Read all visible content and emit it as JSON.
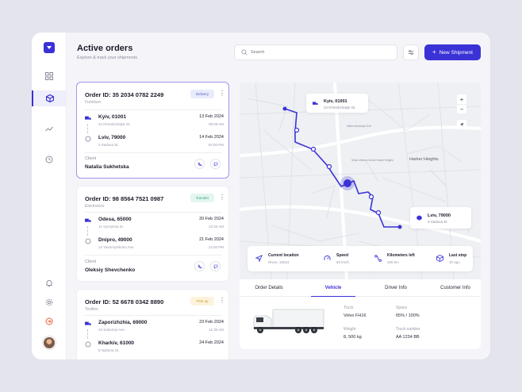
{
  "header": {
    "title": "Active orders",
    "subtitle": "Explore & track your shipments",
    "search_placeholder": "Search",
    "new_button": "New Shipment"
  },
  "colors": {
    "accent": "#3a32d6",
    "delivery_bg": "#e9ecfb",
    "delivery_fg": "#5a62c9",
    "transfer_bg": "#e3f6ef",
    "transfer_fg": "#3aa47a",
    "pickup_bg": "#fdf3dc",
    "pickup_fg": "#c89a2b",
    "logout": "#e8603a"
  },
  "sidebar": {
    "items": [
      "logo-icon",
      "grid-icon",
      "box-icon",
      "chart-icon",
      "history-icon",
      "bell-icon",
      "settings-icon",
      "logout-icon"
    ]
  },
  "orders": [
    {
      "id": "Order ID: 35 2034 0782 2249",
      "category": "Furniture",
      "status": "Delivery",
      "from": {
        "city": "Kyiv, 01001",
        "address": "24 Khreshchatyk St.",
        "date": "13 Feb 2024",
        "time": "09:08 AM"
      },
      "to": {
        "city": "Lviv, 79000",
        "address": "3 Sadova St.",
        "date": "14 Feb 2024",
        "time": "02:00 PM"
      },
      "client_label": "Client",
      "client": "Natalia Sukhetska"
    },
    {
      "id": "Order ID: 98 8564 7521 0987",
      "category": "Electronics",
      "status": "Transfer",
      "from": {
        "city": "Odesa, 65000",
        "address": "11 Vynnytsia St.",
        "date": "20 Feb 2024",
        "time": "10:35 AM"
      },
      "to": {
        "city": "Dnipro, 49000",
        "address": "12 Yavornytskoho Ave.",
        "date": "21 Feb 2024",
        "time": "12:00 PM"
      },
      "client_label": "Client",
      "client": "Oleksiy Shevchenko"
    },
    {
      "id": "Order ID: 52 6678 0342 8890",
      "category": "Textiles",
      "status": "Pick up",
      "from": {
        "city": "Zaporizhzhia, 69000",
        "address": "23 Sobornyi Ave.",
        "date": "23 Feb 2024",
        "time": "11:30 AM"
      },
      "to": {
        "city": "Kharkiv, 61000",
        "address": "8 Nahirna St.",
        "date": "24 Feb 2024",
        "time": ""
      }
    }
  ],
  "map": {
    "origin": {
      "city": "Kyiv, 01001",
      "address": "24 Khreshchatyk St."
    },
    "destination": {
      "city": "Lviv, 79000",
      "address": "3 Sadova St."
    },
    "labels": [
      "Harker Heights",
      "Killeen Municipal Golf",
      "Seton Medical Center Harker Heights"
    ],
    "stats": [
      {
        "label": "Current location",
        "value": "Rivne, 33024"
      },
      {
        "label": "Speed",
        "value": "80 km/h"
      },
      {
        "label": "Kilometers left",
        "value": "290 km"
      },
      {
        "label": "Last stop",
        "value": "3h ago"
      }
    ]
  },
  "details": {
    "tabs": [
      "Order Details",
      "Vehicle",
      "Driver Info",
      "Customer Info"
    ],
    "active_tab": "Vehicle",
    "truck_label": "Truck",
    "truck": "Volvo FH16",
    "space_label": "Space",
    "space": "65% / 100%",
    "weight_label": "Weight",
    "weight": "8, 500 kg",
    "number_label": "Truck number",
    "number": "AA 1234 BB"
  }
}
